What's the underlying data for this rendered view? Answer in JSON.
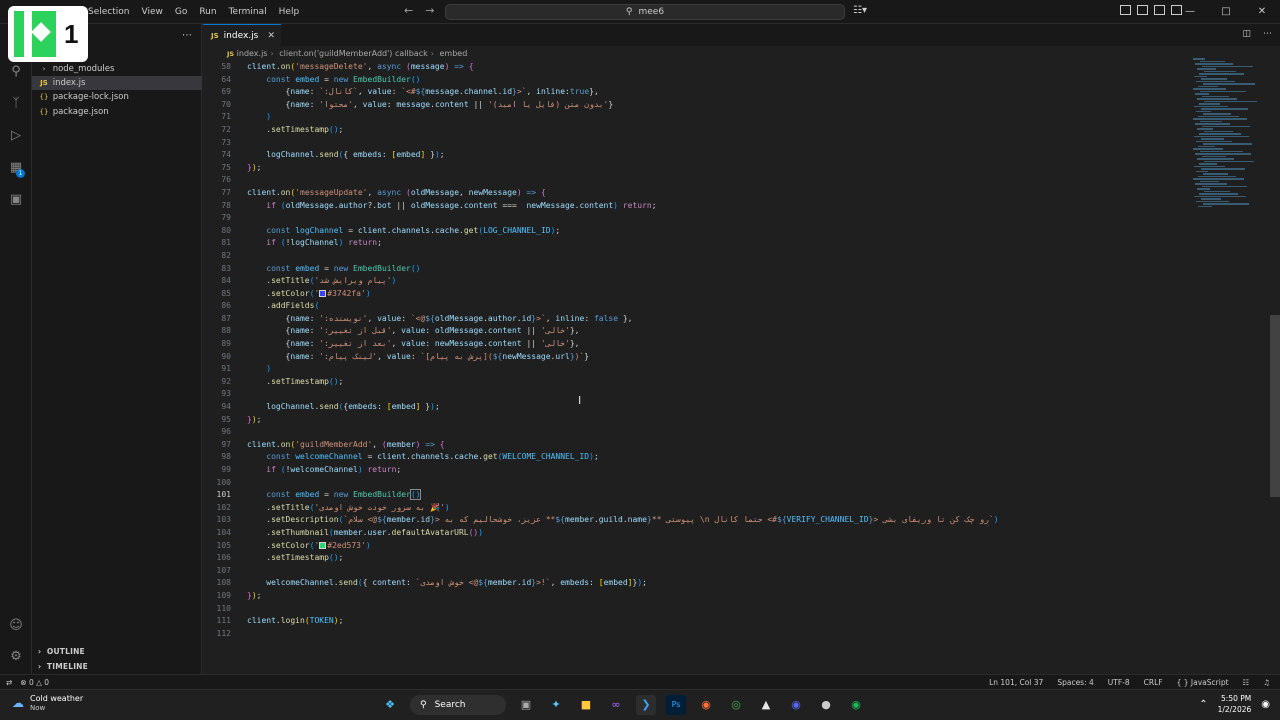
{
  "logo": {
    "number": "1"
  },
  "menu": [
    "Selection",
    "View",
    "Go",
    "Run",
    "Terminal",
    "Help"
  ],
  "search": {
    "text": "mee6"
  },
  "sidebar": {
    "items": [
      {
        "label": "node_modules",
        "icon": "chevron-right-icon"
      },
      {
        "label": "index.js",
        "icon": "js-file-icon"
      },
      {
        "label": "package-lock.json",
        "icon": "json-file-icon"
      },
      {
        "label": "package.json",
        "icon": "json-file-icon"
      }
    ],
    "outline": "OUTLINE",
    "timeline": "TIMELINE"
  },
  "tab": {
    "label": "index.js"
  },
  "breadcrumb": [
    "index.js",
    "client.on('guildMemberAdd') callback",
    "embed"
  ],
  "status": {
    "errors": "0",
    "warnings": "0",
    "position": "Ln 101, Col 37",
    "spaces": "Spaces: 4",
    "encoding": "UTF-8",
    "eol": "CRLF",
    "language": "JavaScript"
  },
  "taskbar": {
    "weather_title": "Cold weather",
    "weather_sub": "Now",
    "search_label": "Search",
    "time": "5:50 PM",
    "date": "1/2/2026"
  },
  "colors": {
    "accent": "#0078d4",
    "swatch1": "#3742fa",
    "swatch2": "#2ed573"
  },
  "code_lines": [
    {
      "n": "58",
      "html": "<span class='v'>client</span><span class='p'>.</span><span class='f'>on</span><span class='b'>(</span><span class='s'>'messageDelete'</span><span class='p'>, </span><span class='k'>async</span><span class='p'> </span><span class='bp'>(</span><span class='v'>message</span><span class='bp'>)</span><span class='p'> </span><span class='k'>=&gt;</span><span class='p'> </span><span class='bp'>{</span>"
    },
    {
      "n": "64",
      "html": "    <span class='k'>const</span> <span class='c'>embed</span> <span class='p'>=</span> <span class='k'>new</span> <span class='t'>EmbedBuilder</span><span class='bb'>()</span>"
    },
    {
      "n": "69",
      "html": "        <span class='p'>{</span><span class='v'>name</span><span class='p'>: </span><span class='s'>`:کانال`</span><span class='p'>, </span><span class='v'>value</span><span class='p'>: </span><span class='s'>`&lt;#</span><span class='k'>${</span><span class='v'>message</span><span class='p'>.</span><span class='v'>channel</span><span class='p'>.</span><span class='v'>id</span><span class='k'>}</span><span class='s'>&gt;`</span><span class='p'>, </span><span class='v'>inline</span><span class='p'>:</span><span class='k'>true</span><span class='p'>},</span>"
    },
    {
      "n": "70",
      "html": "        <span class='p'>{</span><span class='v'>name</span><span class='p'>: </span><span class='s'>'محتوا'</span><span class='p'>, </span><span class='v'>value</span><span class='p'>: </span><span class='v'>message</span><span class='p'>.</span><span class='v'>content</span><span class='p'> || </span><span class='s'>'(بدون متن (فایل یا امبد'</span><span class='p'>}</span>"
    },
    {
      "n": "71",
      "html": "    <span class='bb'>)</span>"
    },
    {
      "n": "72",
      "html": "    <span class='p'>.</span><span class='f'>setTimestamp</span><span class='bb'>()</span><span class='p'>;</span>"
    },
    {
      "n": "73",
      "html": ""
    },
    {
      "n": "74",
      "html": "    <span class='v'>logChannel</span><span class='p'>.</span><span class='f'>send</span><span class='bb'>(</span><span class='p'>{ </span><span class='v'>embeds</span><span class='p'>: </span><span class='b'>[</span><span class='v'>embed</span><span class='b'>]</span><span class='p'> }</span><span class='bb'>)</span><span class='p'>;</span>"
    },
    {
      "n": "75",
      "html": "<span class='bp'>}</span><span class='b'>)</span><span class='p'>;</span>"
    },
    {
      "n": "76",
      "html": ""
    },
    {
      "n": "77",
      "html": "<span class='v'>client</span><span class='p'>.</span><span class='f'>on</span><span class='b'>(</span><span class='s'>'messageUpdate'</span><span class='p'>, </span><span class='k'>async</span><span class='p'> </span><span class='bp'>(</span><span class='v'>oldMessage</span><span class='p'>, </span><span class='v'>newMessage</span><span class='bp'>)</span><span class='p'> </span><span class='k'>=&gt;</span><span class='p'> </span><span class='bp'>{</span>"
    },
    {
      "n": "78",
      "html": "    <span class='kw'>if</span> <span class='bb'>(</span><span class='v'>oldMessage</span><span class='p'>.</span><span class='v'>author</span><span class='p'>?.</span><span class='v'>bot</span><span class='p'> || </span><span class='v'>oldMessage</span><span class='p'>.</span><span class='v'>content</span><span class='p'> ===  </span><span class='v'>newMessage</span><span class='p'>.</span><span class='v'>content</span><span class='bb'>)</span> <span class='kw'>return</span><span class='p'>;</span>"
    },
    {
      "n": "79",
      "html": ""
    },
    {
      "n": "80",
      "html": "    <span class='k'>const</span> <span class='c'>logChannel</span> <span class='p'>=</span> <span class='v'>client</span><span class='p'>.</span><span class='v'>channels</span><span class='p'>.</span><span class='v'>cache</span><span class='p'>.</span><span class='f'>get</span><span class='bb'>(</span><span class='c'>LOG_CHANNEL_ID</span><span class='bb'>)</span><span class='p'>;</span>"
    },
    {
      "n": "81",
      "html": "    <span class='kw'>if</span> <span class='bb'>(</span><span class='p'>!</span><span class='v'>logChannel</span><span class='bb'>)</span> <span class='kw'>return</span><span class='p'>;</span>"
    },
    {
      "n": "82",
      "html": ""
    },
    {
      "n": "83",
      "html": "    <span class='k'>const</span> <span class='c'>embed</span> <span class='p'>=</span> <span class='k'>new</span> <span class='t'>EmbedBuilder</span><span class='bb'>()</span>"
    },
    {
      "n": "84",
      "html": "    <span class='p'>.</span><span class='f'>setTitle</span><span class='bb'>(</span><span class='s'>'پیام ویرایش شد'</span><span class='bb'>)</span>"
    },
    {
      "n": "85",
      "html": "    <span class='p'>.</span><span class='f'>setColor</span><span class='bb'>(</span><span class='s'>'<span class=\"swatch\" style=\"background:#3742fa\"></span>#3742fa'</span><span class='bb'>)</span>"
    },
    {
      "n": "86",
      "html": "    <span class='p'>.</span><span class='f'>addFields</span><span class='bb'>(</span>"
    },
    {
      "n": "87",
      "html": "        <span class='p'>{</span><span class='v'>name</span><span class='p'>: </span><span class='s'>':نویسنده'</span><span class='p'>, </span><span class='v'>value</span><span class='p'>: </span><span class='s'>`&lt;@</span><span class='k'>${</span><span class='v'>oldMessage</span><span class='p'>.</span><span class='v'>author</span><span class='p'>.</span><span class='v'>id</span><span class='k'>}</span><span class='s'>&gt;`</span><span class='p'>, </span><span class='v'>inline</span><span class='p'>: </span><span class='k'>false</span><span class='p'> },</span>"
    },
    {
      "n": "88",
      "html": "        <span class='p'>{</span><span class='v'>name</span><span class='p'>: </span><span class='s'>':قبل از تغییر'</span><span class='p'>, </span><span class='v'>value</span><span class='p'>: </span><span class='v'>oldMessage</span><span class='p'>.</span><span class='v'>content</span><span class='p'> || </span><span class='s'>'خالی'</span><span class='p'>},</span>"
    },
    {
      "n": "89",
      "html": "        <span class='p'>{</span><span class='v'>name</span><span class='p'>: </span><span class='s'>':بعد از تغییر'</span><span class='p'>, </span><span class='v'>value</span><span class='p'>: </span><span class='v'>newMessage</span><span class='p'>.</span><span class='v'>content</span><span class='p'> || </span><span class='s'>'خالی'</span><span class='p'>},</span>"
    },
    {
      "n": "90",
      "html": "        <span class='p'>{</span><span class='v'>name</span><span class='p'>: </span><span class='s'>':لینک پیام'</span><span class='p'>, </span><span class='v'>value</span><span class='p'>: </span><span class='s'>`[پرش به پیام](</span><span class='k'>${</span><span class='v'>newMessage</span><span class='p'>.</span><span class='v'>url</span><span class='k'>}</span><span class='s'>)`</span><span class='p'>}</span>"
    },
    {
      "n": "91",
      "html": "    <span class='bb'>)</span>"
    },
    {
      "n": "92",
      "html": "    <span class='p'>.</span><span class='f'>setTimestamp</span><span class='bb'>()</span><span class='p'>;</span>"
    },
    {
      "n": "93",
      "html": ""
    },
    {
      "n": "94",
      "html": "    <span class='v'>logChannel</span><span class='p'>.</span><span class='f'>send</span><span class='bb'>(</span><span class='p'>{</span><span class='v'>embeds</span><span class='p'>: </span><span class='b'>[</span><span class='v'>embed</span><span class='b'>]</span><span class='p'> }</span><span class='bb'>)</span><span class='p'>;</span>"
    },
    {
      "n": "95",
      "html": "<span class='bp'>}</span><span class='b'>)</span><span class='p'>;</span>"
    },
    {
      "n": "96",
      "html": ""
    },
    {
      "n": "97",
      "html": "<span class='v'>client</span><span class='p'>.</span><span class='f'>on</span><span class='b'>(</span><span class='s'>'guildMemberAdd'</span><span class='p'>, </span><span class='bp'>(</span><span class='v'>member</span><span class='bp'>)</span><span class='p'> </span><span class='k'>=&gt;</span><span class='p'> </span><span class='bp'>{</span>"
    },
    {
      "n": "98",
      "html": "    <span class='k'>const</span> <span class='c'>welcomeChannel</span> <span class='p'>=</span> <span class='v'>client</span><span class='p'>.</span><span class='v'>channels</span><span class='p'>.</span><span class='v'>cache</span><span class='p'>.</span><span class='f'>get</span><span class='bb'>(</span><span class='c'>WELCOME_CHANNEL_ID</span><span class='bb'>)</span><span class='p'>;</span>"
    },
    {
      "n": "99",
      "html": "    <span class='kw'>if</span> <span class='bb'>(</span><span class='p'>!</span><span class='v'>welcomeChannel</span><span class='bb'>)</span> <span class='kw'>return</span><span class='p'>;</span>"
    },
    {
      "n": "100",
      "html": ""
    },
    {
      "n": "101",
      "active": true,
      "html": "    <span class='k'>const</span> <span class='c'>embed</span> <span class='p'>=</span> <span class='k'>new</span> <span class='t'>EmbedBuilder</span><span class='bb' style='outline:1px solid #888'>()</span>"
    },
    {
      "n": "102",
      "html": "    <span class='p'>.</span><span class='f'>setTitle</span><span class='bb'>(</span><span class='s'>'به سرور خودت خوش اومدی 🎉'</span><span class='bb'>)</span>"
    },
    {
      "n": "103",
      "html": "    <span class='p'>.</span><span class='f'>setDescription</span><span class='bb'>(</span><span class='s'>`سلام &lt;@</span><span class='k'>${</span><span class='v'>member</span><span class='p'>.</span><span class='v'>id</span><span class='k'>}</span><span class='s'>&gt; عزیز، خوشحالیم که به **</span><span class='k'>${</span><span class='v'>member</span><span class='p'>.</span><span class='v'>guild</span><span class='p'>.</span><span class='v'>name</span><span class='k'>}</span><span class='s'>** پیوستی \\n حتما کانال &lt;#</span><span class='k'>${</span><span class='c'>VERIFY_CHANNEL_ID</span><span class='k'>}</span><span class='s'>&gt; رو چک کن تا وریفای بشی`</span><span class='bb'>)</span>"
    },
    {
      "n": "104",
      "html": "    <span class='p'>.</span><span class='f'>setThumbnail</span><span class='bb'>(</span><span class='v'>member</span><span class='p'>.</span><span class='v'>user</span><span class='p'>.</span><span class='f'>defaultAvatarURL</span><span class='bp'>()</span><span class='bb'>)</span>"
    },
    {
      "n": "105",
      "html": "    <span class='p'>.</span><span class='f'>setColor</span><span class='bb'>(</span><span class='s'>'<span class=\"swatch\" style=\"background:#2ed573\"></span>#2ed573'</span><span class='bb'>)</span>"
    },
    {
      "n": "106",
      "html": "    <span class='p'>.</span><span class='f'>setTimestamp</span><span class='bb'>()</span><span class='p'>;</span>"
    },
    {
      "n": "107",
      "html": ""
    },
    {
      "n": "108",
      "html": "    <span class='v'>welcomeChannel</span><span class='p'>.</span><span class='f'>send</span><span class='bb'>(</span><span class='p'>{ </span><span class='v'>content</span><span class='p'>: </span><span class='s'>`خوش اومدی &lt;@</span><span class='k'>${</span><span class='v'>member</span><span class='p'>.</span><span class='v'>id</span><span class='k'>}</span><span class='s'>&gt;!`</span><span class='p'>, </span><span class='v'>embeds</span><span class='p'>: </span><span class='b'>[</span><span class='v'>embed</span><span class='b'>]</span><span class='p'>}</span><span class='bb'>)</span><span class='p'>;</span>"
    },
    {
      "n": "109",
      "html": "<span class='bp'>}</span><span class='b'>)</span><span class='p'>;</span>"
    },
    {
      "n": "110",
      "html": ""
    },
    {
      "n": "111",
      "html": "<span class='v'>client</span><span class='p'>.</span><span class='f'>login</span><span class='b'>(</span><span class='c'>TOKEN</span><span class='b'>)</span><span class='p'>;</span>"
    },
    {
      "n": "112",
      "html": ""
    }
  ]
}
